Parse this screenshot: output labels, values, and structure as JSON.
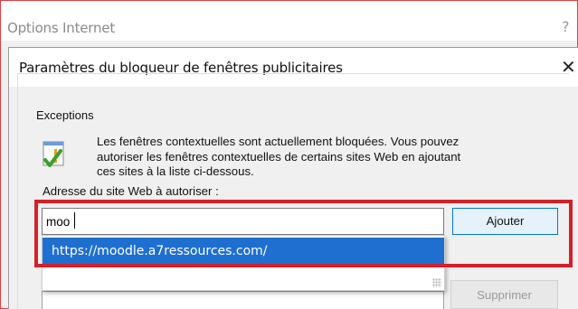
{
  "outer_window": {
    "title": "Options Internet",
    "help_glyph": "?"
  },
  "dialog": {
    "title": "Paramètres du bloqueur de fenêtres publicitaires",
    "close_glyph": "✕"
  },
  "exceptions": {
    "legend": "Exceptions",
    "info_lines": [
      "Les fenêtres contextuelles sont actuellement bloquées. Vous pouvez",
      "autoriser les fenêtres contextuelles de certains sites Web en ajoutant",
      "ces sites à la liste ci-dessous."
    ],
    "info_icon": "shield-check-warning-icon",
    "address_label": "Adresse du site Web à autoriser :",
    "address_value": "moo",
    "add_button": "Ajouter",
    "remove_button": "Supprimer"
  },
  "autocomplete": {
    "suggestions": [
      "https://moodle.a7ressources.com/"
    ]
  },
  "colors": {
    "highlight": "#d4202a",
    "selection": "#1e6fcf",
    "button_focus_border": "#0078d7"
  }
}
